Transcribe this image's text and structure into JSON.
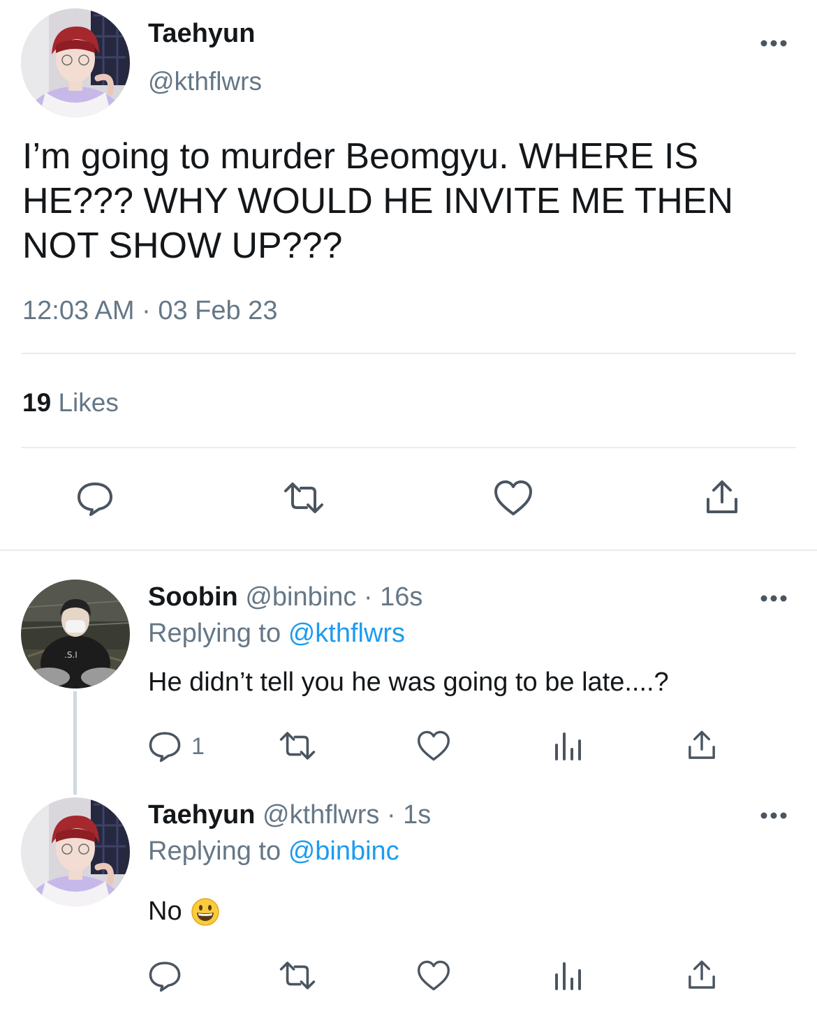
{
  "main_tweet": {
    "author_name": "Taehyun",
    "author_handle": "@kthflwrs",
    "text": "I’m going to murder Beomgyu. WHERE IS HE??? WHY WOULD HE INVITE ME THEN NOT SHOW UP???",
    "timestamp": "12:03 AM · 03 Feb 23",
    "likes_count": "19",
    "likes_label": "Likes",
    "actions": [
      "reply-icon",
      "retweet-icon",
      "like-icon",
      "share-icon"
    ]
  },
  "replies": [
    {
      "author_name": "Soobin",
      "author_handle": "@binbinc",
      "age": "· 16s",
      "replying_label": "Replying to",
      "replying_to": "@kthflwrs",
      "text": "He didn’t tell you he was going to be late....?",
      "reply_count": "1",
      "actions": [
        "reply-icon",
        "retweet-icon",
        "like-icon",
        "analytics-icon",
        "share-icon"
      ]
    },
    {
      "author_name": "Taehyun",
      "author_handle": "@kthflwrs",
      "age": "· 1s",
      "replying_label": "Replying to",
      "replying_to": "@binbinc",
      "text": "No",
      "emoji": "grinning-face-icon",
      "actions": [
        "reply-icon",
        "retweet-icon",
        "like-icon",
        "analytics-icon",
        "share-icon"
      ]
    }
  ],
  "colors": {
    "text": "#14171a",
    "secondary": "#657786",
    "link": "#1d9bf0",
    "divider": "#e6ecf0",
    "icon": "#4a5560"
  }
}
